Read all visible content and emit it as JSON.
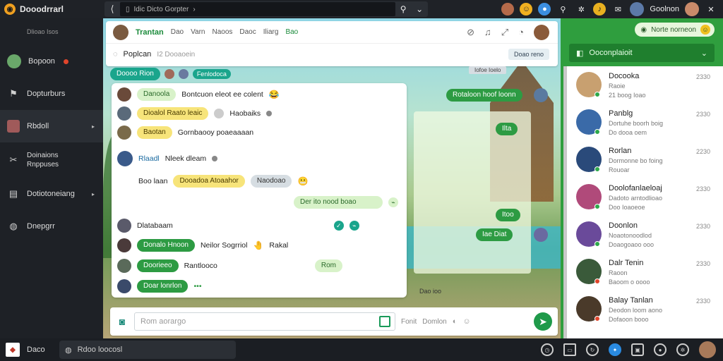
{
  "app": {
    "title": "Dooodrrarl"
  },
  "address": {
    "url": "Idic Dicto Gorpter",
    "chevron": "›"
  },
  "topbar": {
    "user_name": "Goolnon"
  },
  "sidebar": {
    "header": "Dlioao Isos",
    "items": [
      {
        "label": "Bopoon",
        "icon": "avatar-icon"
      },
      {
        "label": "Dopturburs",
        "icon": "flag-icon"
      },
      {
        "label": "Rbdoll",
        "icon": "people-icon"
      },
      {
        "label": "Doinaions\nRnppuses",
        "icon": "tools-icon"
      },
      {
        "label": "Dotiotoneiang",
        "icon": "board-icon"
      },
      {
        "label": "Dnepgrr",
        "icon": "globe-icon"
      }
    ]
  },
  "chat": {
    "header_links": [
      "Trantan",
      "Dao",
      "Varn",
      "Naoos",
      "Daoc",
      "Iliarg",
      "Bao"
    ],
    "sub_title": "Poplcan",
    "sub_caption": "I2 Dooaoein",
    "sub_button": "Doao reno",
    "tag": "Doooo Rion",
    "tag_caption": "Fenlodoca",
    "mini_bar": "Iofoe Ioelo",
    "messages": {
      "m1_pill": "Danoola",
      "m1_text": "Bontcuon eleot ee colent",
      "m2_pill": "Dioalol  Raato leaic",
      "m2_text": "Haobaiks",
      "m3_pill": "Baotan",
      "m3_text": "Gornbaooy poaeaaaan",
      "m4_name": "Rlaadl",
      "m4_text": "Nleek dleam",
      "m5_label": "Boo laan",
      "m5_pill": "Dooadoa Atoaahor",
      "m5_grey": "Naodoao",
      "m6_pill": "Der ito nood boao",
      "m7_name": "Dlatabaam",
      "m8_pill": "Donalo Hnoon",
      "m8_text": "Neilor Sogrriol",
      "m8_tail": "Rakal",
      "m9_pill": "Doorieeo",
      "m9_text": "Rantlooco",
      "m10_pill": "Doar lonrlon",
      "m11_pill": "Rom"
    },
    "right_bubbles": [
      "Rotaloon hoof loonn",
      "Ilta",
      "Itoo",
      "Iae Diat"
    ],
    "time_stamp": "Dao ioo",
    "composer": {
      "placeholder": "Rom aorargo",
      "action1": "Fonit",
      "action2": "Domlon"
    }
  },
  "contacts": {
    "status_label": "Norte norneon",
    "selector": "Ooconplaioit",
    "list": [
      {
        "name": "Docooka",
        "line1": "Raoie",
        "line2": "21 boog Ioao",
        "time": "2330"
      },
      {
        "name": "Panblg",
        "line1": "Dortuhe boorh boig",
        "line2": "Do dooa oem",
        "time": "2330"
      },
      {
        "name": "Rorlan",
        "line1": "Dormonne bo foing",
        "line2": "Rouoar",
        "time": "2230"
      },
      {
        "name": "Doolofanlaeloaj",
        "line1": "Dadoto arntodlioao",
        "line2": "Doo Ioaoeoe",
        "time": "2330"
      },
      {
        "name": "Doonlon",
        "line1": "Noaotonoodlod",
        "line2": "Doaogoaoo ooo",
        "time": "2330"
      },
      {
        "name": "Dalr Tenin",
        "line1": "Raoon",
        "line2": "Baoom o oooo",
        "time": "2330"
      },
      {
        "name": "Balay Tanlan",
        "line1": "Deodon loom aono",
        "line2": "Dofaoon booo",
        "time": "2330"
      }
    ]
  },
  "bottombar": {
    "label": "Daco",
    "search": "Rdoo loocosl"
  },
  "colors": {
    "accent": "#2d9b43",
    "brand": "#f0a020"
  }
}
